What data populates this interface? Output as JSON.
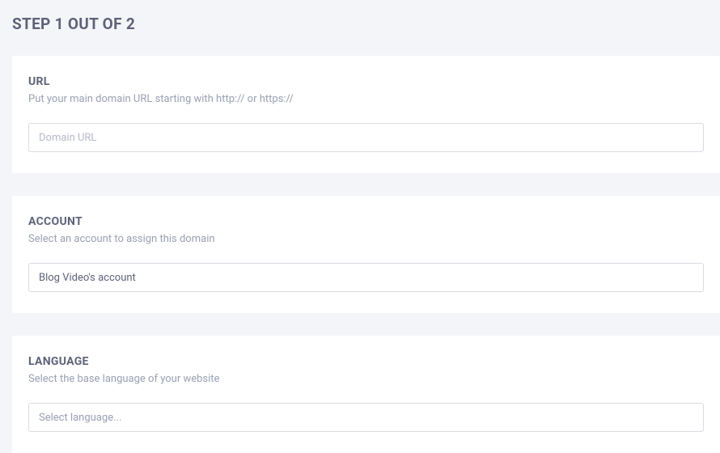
{
  "page": {
    "title": "STEP 1 OUT OF 2"
  },
  "url_section": {
    "title": "URL",
    "desc": "Put your main domain URL starting with http:// or https://",
    "placeholder": "Domain URL",
    "value": ""
  },
  "account_section": {
    "title": "ACCOUNT",
    "desc": "Select an account to assign this domain",
    "selected": "Blog Video's account"
  },
  "language_section": {
    "title": "LANGUAGE",
    "desc": "Select the base language of your website",
    "placeholder": "Select language..."
  }
}
